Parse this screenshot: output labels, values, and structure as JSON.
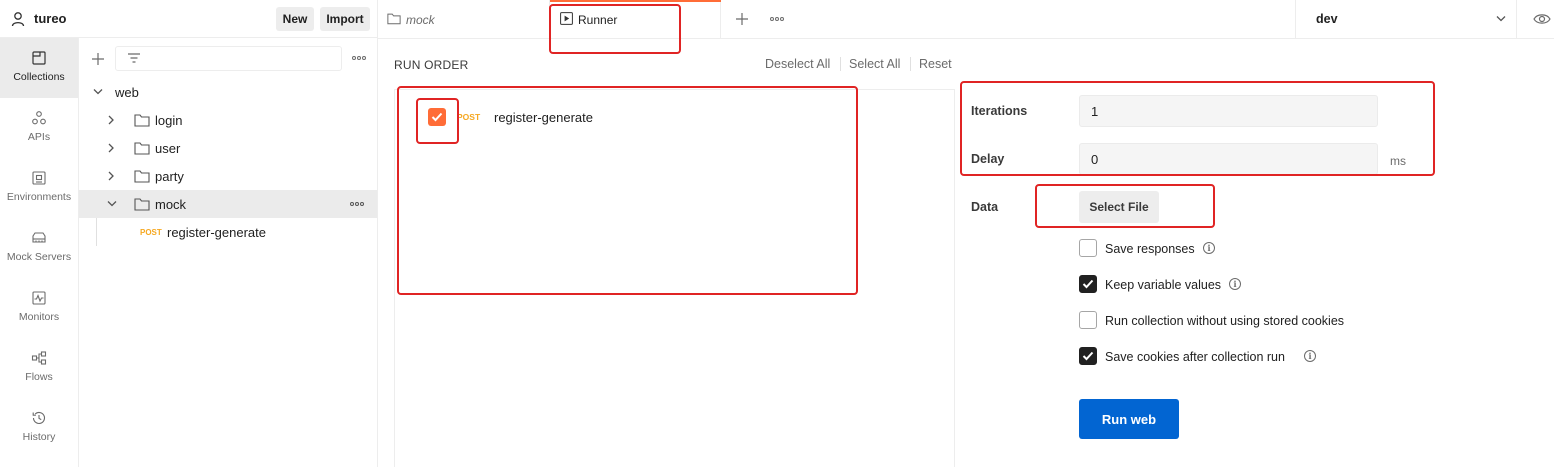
{
  "workspace": {
    "name": "tureo",
    "new_label": "New",
    "import_label": "Import"
  },
  "rail": {
    "items": [
      {
        "label": "Collections",
        "icon": "collections-icon"
      },
      {
        "label": "APIs",
        "icon": "apis-icon"
      },
      {
        "label": "Environments",
        "icon": "environments-icon"
      },
      {
        "label": "Mock Servers",
        "icon": "mock-servers-icon"
      },
      {
        "label": "Monitors",
        "icon": "monitors-icon"
      },
      {
        "label": "Flows",
        "icon": "flows-icon"
      },
      {
        "label": "History",
        "icon": "history-icon"
      }
    ]
  },
  "tree": {
    "root": "web",
    "folders": [
      "login",
      "user",
      "party",
      "mock"
    ],
    "request": {
      "method": "POST",
      "name": "register-generate"
    }
  },
  "tabs": {
    "items": [
      {
        "label": "mock"
      },
      {
        "label": "Runner"
      }
    ],
    "environment": "dev"
  },
  "runner": {
    "run_order_title": "RUN ORDER",
    "deselect_all": "Deselect All",
    "select_all": "Select All",
    "reset": "Reset",
    "request": {
      "method": "POST",
      "name": "register-generate",
      "checked": true
    },
    "iterations_label": "Iterations",
    "iterations_value": "1",
    "delay_label": "Delay",
    "delay_value": "0",
    "delay_unit": "ms",
    "data_label": "Data",
    "select_file": "Select File",
    "options": [
      {
        "label": "Save responses",
        "checked": false,
        "info": true
      },
      {
        "label": "Keep variable values",
        "checked": true,
        "info": true
      },
      {
        "label": "Run collection without using stored cookies",
        "checked": false,
        "info": false
      },
      {
        "label": "Save cookies after collection run",
        "checked": true,
        "info": true
      }
    ],
    "run_button": "Run web"
  },
  "colors": {
    "accent": "#ff6c37",
    "run_button": "#0265d2",
    "annotation": "#e02424",
    "post_method": "#f6a821"
  }
}
